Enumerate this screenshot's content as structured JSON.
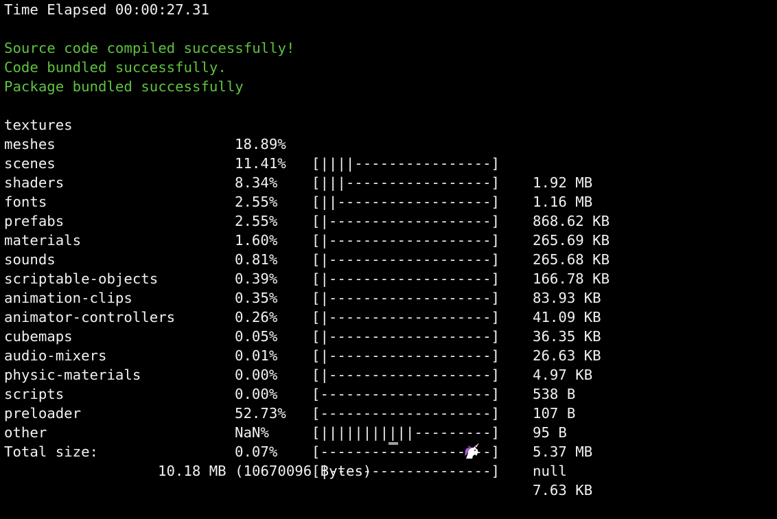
{
  "header": {
    "time_elapsed": "Time Elapsed 00:00:27.31"
  },
  "status_messages": [
    "Source code compiled successfully!",
    "Code bundled successfully.",
    "Package bundled successfully"
  ],
  "bundle_rows": [
    {
      "name": "textures",
      "percent": "18.89%",
      "bar": "[||||----------------]",
      "size": "1.92 MB"
    },
    {
      "name": "meshes",
      "percent": "11.41%",
      "bar": "[|||-----------------]",
      "size": "1.16 MB"
    },
    {
      "name": "scenes",
      "percent": "8.34%",
      "bar": "[||------------------]",
      "size": "868.62 KB"
    },
    {
      "name": "shaders",
      "percent": "2.55%",
      "bar": "[|-------------------]",
      "size": "265.69 KB"
    },
    {
      "name": "fonts",
      "percent": "2.55%",
      "bar": "[|-------------------]",
      "size": "265.68 KB"
    },
    {
      "name": "prefabs",
      "percent": "1.60%",
      "bar": "[|-------------------]",
      "size": "166.78 KB"
    },
    {
      "name": "materials",
      "percent": "0.81%",
      "bar": "[|-------------------]",
      "size": "83.93 KB"
    },
    {
      "name": "sounds",
      "percent": "0.39%",
      "bar": "[|-------------------]",
      "size": "41.09 KB"
    },
    {
      "name": "scriptable-objects",
      "percent": "0.35%",
      "bar": "[|-------------------]",
      "size": "36.35 KB"
    },
    {
      "name": "animation-clips",
      "percent": "0.26%",
      "bar": "[|-------------------]",
      "size": "26.63 KB"
    },
    {
      "name": "animator-controllers",
      "percent": "0.05%",
      "bar": "[|-------------------]",
      "size": "4.97 KB"
    },
    {
      "name": "cubemaps",
      "percent": "0.01%",
      "bar": "[|-------------------]",
      "size": "538 B"
    },
    {
      "name": "audio-mixers",
      "percent": "0.00%",
      "bar": "[--------------------]",
      "size": "107 B"
    },
    {
      "name": "physic-materials",
      "percent": "0.00%",
      "bar": "[--------------------]",
      "size": "95 B"
    },
    {
      "name": "scripts",
      "percent": "52.73%",
      "bar": "[|||||||||||---------]",
      "size": "5.37 MB"
    },
    {
      "name": "preloader",
      "percent": "NaN%",
      "bar": "[--------------------]",
      "size": "null"
    },
    {
      "name": "other",
      "percent": "0.07%",
      "bar": "[|-------------------]",
      "size": "7.63 KB"
    }
  ],
  "total": {
    "label": "Total size:",
    "value": "10.18 MB (10670096 Bytes)",
    "emoji_icon": "unicorn-icon"
  },
  "colors": {
    "background": "#000000",
    "text": "#f2f2f2",
    "success": "#5fc23f"
  }
}
